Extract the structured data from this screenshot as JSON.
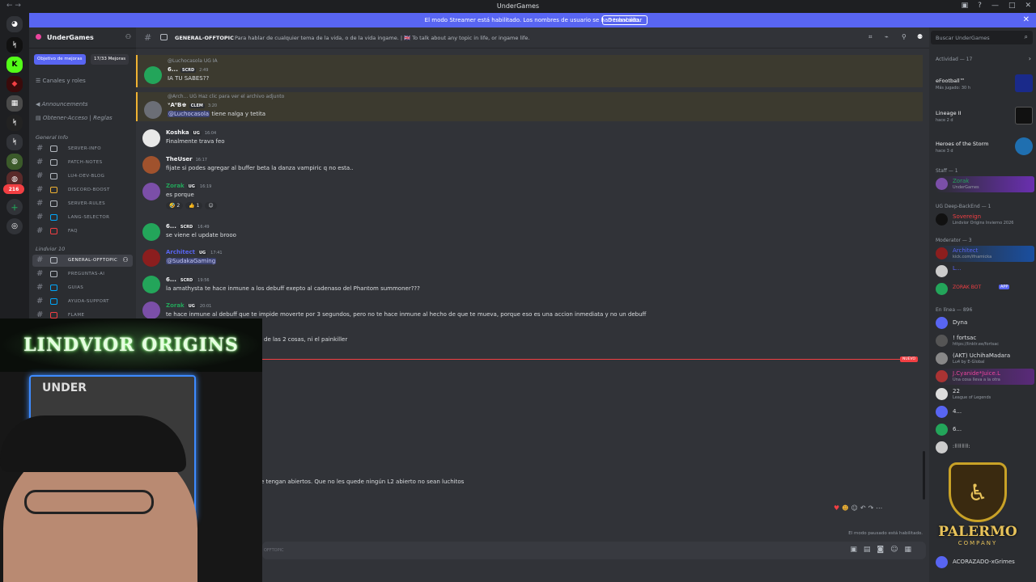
{
  "window": {
    "title": "UnderGames"
  },
  "banner": {
    "text": "El modo Streamer está habilitado. Los nombres de usuario se han truncado.",
    "button": "Deshabilitar"
  },
  "rail": {
    "badge_count": "216"
  },
  "sidebar": {
    "server_name": "UnderGames",
    "boost_goal": "Objetivo de mejoras",
    "boost_count": "17/33 Mejoras",
    "channels_roles": "Canales y roles",
    "top_items": [
      "Announcements",
      "Obtener-Acceso | Reglas"
    ],
    "categories": {
      "general": "General Info",
      "lindvior": "Lindvior 10"
    },
    "channels": [
      "SERVER-INFO",
      "PATCH-NOTES",
      "LU4-DEV-BLOG",
      "DISCORD-BOOST",
      "SERVER-RULES",
      "LANG-SELECTOR",
      "FAQ",
      "GENERAL-OFFTOPIC",
      "PREGUNTAS-AI",
      "GUIAS",
      "AYUDA-SUPPORT",
      "FLAME"
    ]
  },
  "channel": {
    "name": "GENERAL-OFFTOPIC",
    "topic": "Para hablar de cualquier tema de la vida, o de la vida ingame. | 🇬🇧 To talk about any topic in life, or ingame life.",
    "search_placeholder": "Buscar UnderGames"
  },
  "messages": [
    {
      "reply": "@Luchocasola  UG  IA",
      "author": "6...",
      "tag": "SCRD",
      "time": "2:49",
      "text": "IA TU SABES??"
    },
    {
      "reply": "@Arch...  UG  Haz clic para ver el archivo adjunto",
      "author": "ᵛA⁰B♚",
      "tag": "CLEM",
      "time": "3:20",
      "mention": "@Luchocasola",
      "text": "tiene nalga y tetita"
    },
    {
      "author": "Koshka",
      "tag": "UG",
      "time": "16:04",
      "text": "Finalmente trava feo"
    },
    {
      "author": "TheUser",
      "time": "16:17",
      "text": "fijate si podes agregar al buffer beta la danza vampiric q no esta.."
    },
    {
      "author": "Zorak",
      "tag": "UG",
      "time": "16:19",
      "text": "es porque",
      "reactions": [
        "🤣 2",
        "👍 1"
      ]
    },
    {
      "author": "6...",
      "tag": "SCRD",
      "time": "16:49",
      "text": "se viene el update brooo"
    },
    {
      "author": "Architect",
      "tag": "UG",
      "time": "17:41",
      "mention": "@SudakaGaming",
      "text": ""
    },
    {
      "author": "6...",
      "tag": "SCRD",
      "time": "19:56",
      "text": "la amathysta te hace inmune a los debuff exepto al cadenaso del Phantom summoner???"
    },
    {
      "author": "Zorak",
      "tag": "UG",
      "time": "20:01",
      "text": "te hace inmune al debuff que te impide moverte por 3 segundos, pero no te hace inmune al hecho de que te mueva, porque eso es una accion inmediata y no un debuff"
    },
    {
      "text": "de las 2 cosas, ni el painkiller"
    },
    {
      "text": "e tengan abiertos. Que no les quede ningún L2 abierto no sean luchitos"
    }
  ],
  "new_label": "NUEVO",
  "composer": {
    "placeholder": "OFFTOPIC",
    "paused": "El modo pausado está habilitado."
  },
  "members": {
    "activity_header": "Actividad — 17",
    "activities": [
      {
        "name": "eFootball™",
        "sub": "Más jugado: 30 h"
      },
      {
        "name": "Lineage II",
        "sub": "hace 2 d"
      },
      {
        "name": "Heroes of the Storm",
        "sub": "hace 3 d"
      }
    ],
    "staff_header": "Staff — 1",
    "staff": [
      {
        "name": "Zorak",
        "sub": "UnderGames"
      }
    ],
    "backend_header": "UG Deep-BackEnd — 1",
    "backend": [
      {
        "name": "Sovereign",
        "sub": "Lindvior Origins Invierno 2026"
      }
    ],
    "mod_header": "Moderator — 3",
    "mods": [
      {
        "name": "Architect",
        "sub": "kick.com/ifnamicka"
      },
      {
        "name": "L...",
        "sub": ""
      },
      {
        "name": "ZORAK BOT",
        "sub": ""
      }
    ],
    "online_header": "En línea — 896",
    "online": [
      {
        "name": "Dyna",
        "sub": ""
      },
      {
        "name": "! fortsac",
        "sub": "https://linktr.ee/fortsac"
      },
      {
        "name": "(AKT) UchihaMadara",
        "sub": "Lu4 by E-Global"
      },
      {
        "name": "J.Cyanide*Juice.L",
        "sub": "Una cosa lleva a la otra"
      },
      {
        "name": "22",
        "sub": "League of Legends"
      },
      {
        "name": "4...",
        "sub": ""
      },
      {
        "name": "6...",
        "sub": ""
      },
      {
        "name": ":⠿⠿⠿⠿:",
        "sub": ""
      },
      {
        "name": "ACORAZADO-xGrimes",
        "sub": ""
      }
    ]
  },
  "overlay": {
    "logo_text": "LINDVIOR ORIGINS",
    "cam_sign": "UNDER",
    "brand": "PALERMO",
    "brand_sub": "COMPANY"
  }
}
